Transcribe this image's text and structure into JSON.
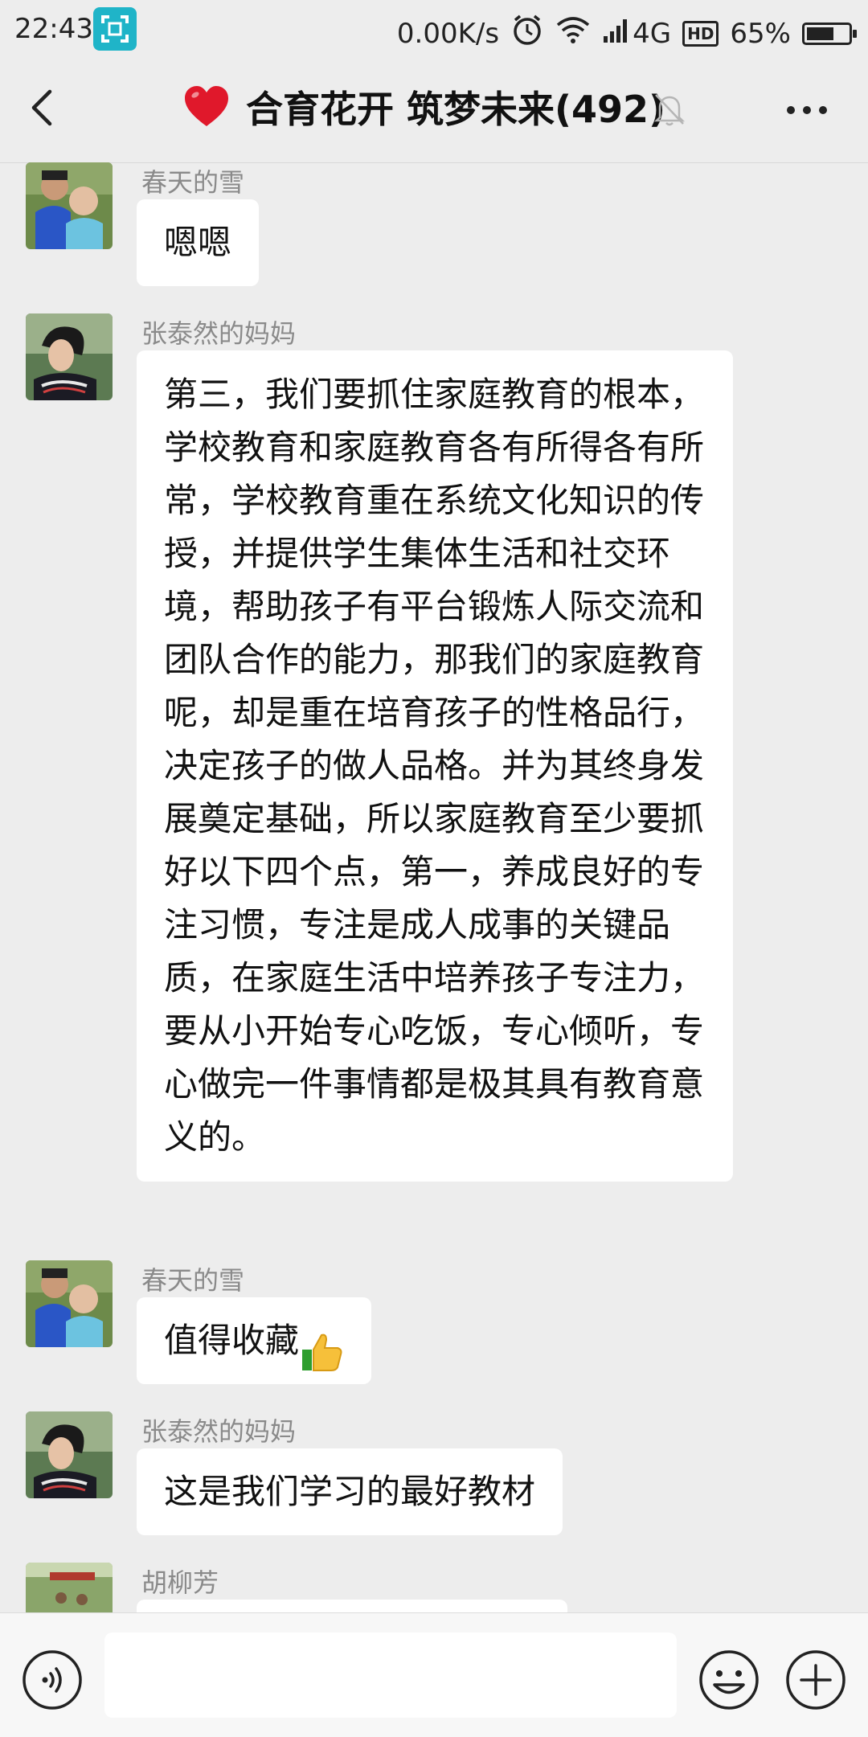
{
  "status_bar": {
    "time": "22:43",
    "network_speed": "0.00K/s",
    "network_type": "4G",
    "hd_badge": "HD",
    "battery": "65%",
    "battery_level": 0.65
  },
  "header": {
    "title": "合育花开 筑梦未来(492)"
  },
  "messages": [
    {
      "sender": "春天的雪",
      "text": "嗯嗯"
    },
    {
      "sender": "张泰然的妈妈",
      "text": "第三，我们要抓住家庭教育的根本，学校教育和家庭教育各有所得各有所常，学校教育重在系统文化知识的传授，并提供学生集体生活和社交环境，帮助孩子有平台锻炼人际交流和团队合作的能力，那我们的家庭教育呢，却是重在培育孩子的性格品行，决定孩子的做人品格。并为其终身发展奠定基础，所以家庭教育至少要抓好以下四个点，第一，养成良好的专注习惯，专注是成人成事的关键品质，在家庭生活中培养孩子专注力，要从小开始专心吃饭，专心倾听，专心做完一件事情都是极其具有教育意义的。"
    },
    {
      "sender": "春天的雪",
      "text": "值得收藏"
    },
    {
      "sender": "张泰然的妈妈",
      "text": "这是我们学习的最好教材"
    },
    {
      "sender": "胡柳芳",
      "text": ""
    }
  ],
  "icons": {
    "back": "chevron-left-icon",
    "mute": "bell-off-icon",
    "more": "more-dots-icon",
    "voice": "voice-icon",
    "emoji": "emoji-icon",
    "plus": "plus-icon",
    "thumbs_up": "thumbs-up-emoji"
  },
  "colors": {
    "background": "#ededed",
    "bubble": "#ffffff",
    "sender_name": "#8a8a8a",
    "heart": "#e0182b"
  }
}
